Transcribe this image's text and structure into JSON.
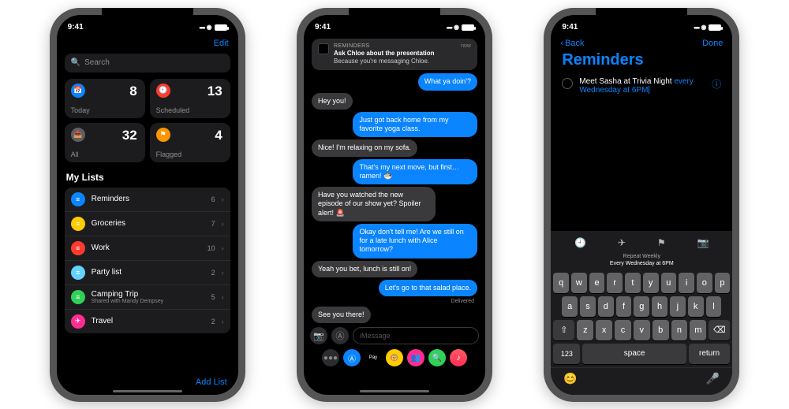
{
  "status": {
    "time": "9:41"
  },
  "reminders_app": {
    "edit": "Edit",
    "search_placeholder": "Search",
    "cards": {
      "today": {
        "label": "Today",
        "count": "8",
        "color": "#0a84ff",
        "glyph": "📅"
      },
      "scheduled": {
        "label": "Scheduled",
        "count": "13",
        "color": "#ff3b30",
        "glyph": "🕘"
      },
      "all": {
        "label": "All",
        "count": "32",
        "color": "#5e5e63",
        "glyph": "📥"
      },
      "flagged": {
        "label": "Flagged",
        "count": "4",
        "color": "#ff9500",
        "glyph": "⚑"
      }
    },
    "lists_title": "My Lists",
    "lists": [
      {
        "name": "Reminders",
        "count": "6",
        "color": "#0a84ff",
        "glyph": "≡"
      },
      {
        "name": "Groceries",
        "count": "7",
        "color": "#ffcc00",
        "glyph": "≡"
      },
      {
        "name": "Work",
        "count": "10",
        "color": "#ff3b30",
        "glyph": "≡"
      },
      {
        "name": "Party list",
        "count": "2",
        "color": "#64d2ff",
        "glyph": "≡"
      },
      {
        "name": "Camping Trip",
        "count": "5",
        "color": "#30d158",
        "glyph": "≡",
        "sub": "Shared with Mandy Dempsey"
      },
      {
        "name": "Travel",
        "count": "2",
        "color": "#ff2d92",
        "glyph": "✈"
      }
    ],
    "add_list": "Add List"
  },
  "messages_app": {
    "notification": {
      "app": "REMINDERS",
      "title": "Ask Chloe about the presentation",
      "subtitle": "Because you're messaging Chloe.",
      "time_label": "now"
    },
    "chat": [
      {
        "side": "out",
        "text": "What ya doin'?"
      },
      {
        "side": "in",
        "text": "Hey you!"
      },
      {
        "side": "out",
        "text": "Just got back home from my favorite yoga class."
      },
      {
        "side": "in",
        "text": "Nice! I'm relaxing on my sofa."
      },
      {
        "side": "out",
        "text": "That's my next move, but first…ramen! 🍜"
      },
      {
        "side": "in",
        "text": "Have you watched the new episode of our show yet? Spoiler alert! 🚨"
      },
      {
        "side": "out",
        "text": "Okay don't tell me! Are we still on for a late lunch with Alice tomorrow?"
      },
      {
        "side": "in",
        "text": "Yeah you bet, lunch is still on!"
      },
      {
        "side": "out",
        "text": "Let's go to that salad place."
      },
      {
        "side": "in",
        "text": "See you there!"
      }
    ],
    "delivered": "Delivered",
    "input_placeholder": "iMessage",
    "appstrip": [
      {
        "name": "store",
        "bg": "#0a84ff",
        "glyph": "Ⓐ"
      },
      {
        "name": "applepay",
        "bg": "#000",
        "glyph": "Pay"
      },
      {
        "name": "animoji",
        "bg": "#ffcc00",
        "glyph": "🐵"
      },
      {
        "name": "memoji",
        "bg": "#ff2d92",
        "glyph": "👥"
      },
      {
        "name": "images",
        "bg": "#30d158",
        "glyph": "🔍"
      },
      {
        "name": "music",
        "bg": "linear-gradient(#ff5a62,#ff2d55)",
        "glyph": "♪"
      }
    ]
  },
  "reminder_edit": {
    "back": "Back",
    "done": "Done",
    "title": "Reminders",
    "item_text": "Meet Sasha at Trivia Night",
    "item_detail": "every Wednesday at 6PM",
    "kb_label_top": "Repeat Weekly",
    "kb_label_bottom": "Every Wednesday at 6PM",
    "keys_row1": [
      "q",
      "w",
      "e",
      "r",
      "t",
      "y",
      "u",
      "i",
      "o",
      "p"
    ],
    "keys_row2": [
      "a",
      "s",
      "d",
      "f",
      "g",
      "h",
      "j",
      "k",
      "l"
    ],
    "keys_row3": [
      "z",
      "x",
      "c",
      "v",
      "b",
      "n",
      "m"
    ],
    "key_shift": "⇧",
    "key_backspace": "⌫",
    "key_numbers": "123",
    "key_space": "space",
    "key_return": "return"
  }
}
